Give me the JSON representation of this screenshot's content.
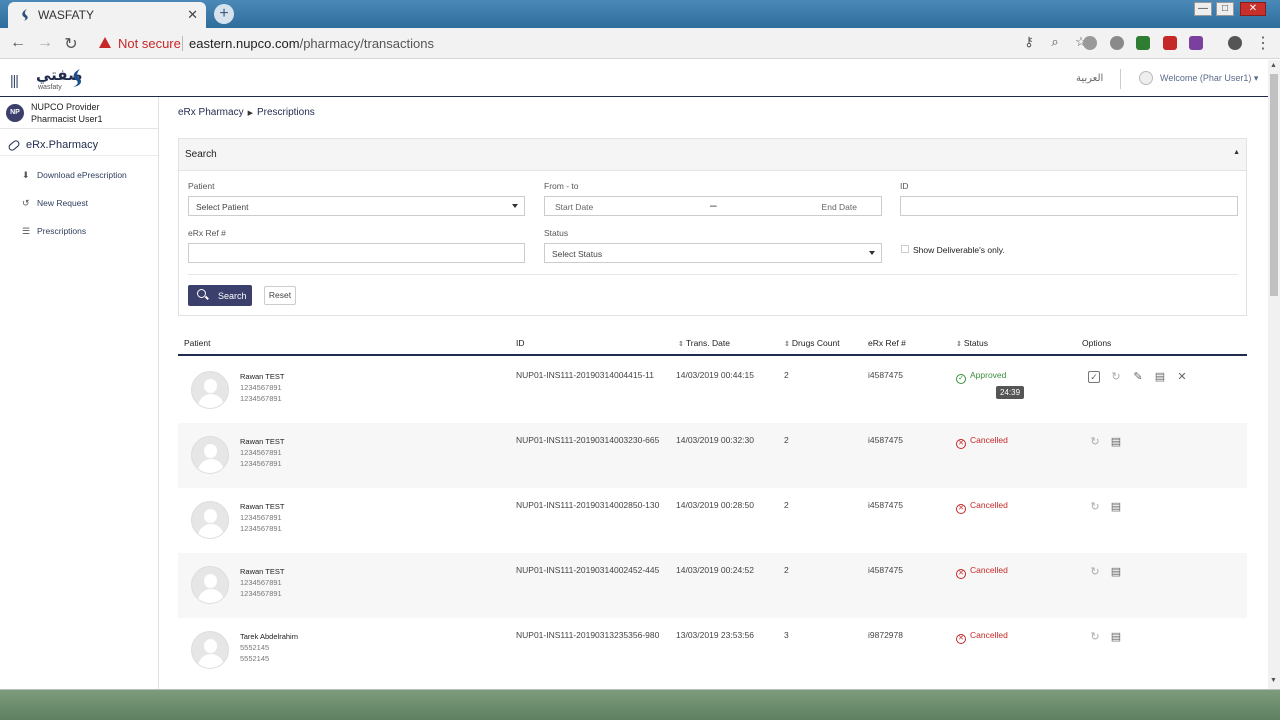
{
  "browser": {
    "tab_title": "WASFATY",
    "tab_close": "✕",
    "new_tab": "+",
    "security_label": "Not secure",
    "url_host": "eastern.nupco.com",
    "url_path": "/pharmacy/transactions",
    "window_controls": [
      "—",
      "□",
      "✕"
    ]
  },
  "header": {
    "logo_ar": "صفتي",
    "logo_en": "wasfaty",
    "language": "العربية",
    "welcome": "Welcome (Phar User1) ▾"
  },
  "sidebar": {
    "avatar_initials": "NP",
    "provider": "NUPCO Provider",
    "user_role": "Pharmacist User1",
    "module": "eRx.Pharmacy",
    "items": [
      {
        "label": "Download ePrescription",
        "icon": "download-icon"
      },
      {
        "label": "New Request",
        "icon": "history-icon"
      },
      {
        "label": "Prescriptions",
        "icon": "list-icon"
      }
    ]
  },
  "breadcrumb": {
    "parent": "eRx Pharmacy",
    "current": "Prescriptions"
  },
  "search": {
    "title": "Search",
    "patient_label": "Patient",
    "patient_placeholder": "Select Patient",
    "fromto_label": "From - to",
    "start_placeholder": "Start Date",
    "end_placeholder": "End Date",
    "id_label": "ID",
    "ref_label": "eRx Ref #",
    "status_label": "Status",
    "status_placeholder": "Select Status",
    "deliverable_label": "Show Deliverable's only.",
    "search_button": "Search",
    "reset_button": "Reset"
  },
  "table": {
    "columns": [
      "Patient",
      "ID",
      "Trans. Date",
      "Drugs Count",
      "eRx Ref #",
      "Status",
      "Options"
    ],
    "rows": [
      {
        "name": "Rawan TEST",
        "num1": "1234567891",
        "num2": "1234567891",
        "id": "NUP01-INS111-20190314004415-11",
        "date": "14/03/2019 00:44:15",
        "count": "2",
        "ref": "i4587475",
        "status": "Approved",
        "status_type": "approved",
        "tooltip": "24:39"
      },
      {
        "name": "Rawan TEST",
        "num1": "1234567891",
        "num2": "1234567891",
        "id": "NUP01-INS111-20190314003230-665",
        "date": "14/03/2019 00:32:30",
        "count": "2",
        "ref": "i4587475",
        "status": "Cancelled",
        "status_type": "cancelled"
      },
      {
        "name": "Rawan TEST",
        "num1": "1234567891",
        "num2": "1234567891",
        "id": "NUP01-INS111-20190314002850-130",
        "date": "14/03/2019 00:28:50",
        "count": "2",
        "ref": "i4587475",
        "status": "Cancelled",
        "status_type": "cancelled"
      },
      {
        "name": "Rawan TEST",
        "num1": "1234567891",
        "num2": "1234567891",
        "id": "NUP01-INS111-20190314002452-445",
        "date": "14/03/2019 00:24:52",
        "count": "2",
        "ref": "i4587475",
        "status": "Cancelled",
        "status_type": "cancelled"
      },
      {
        "name": "Tarek Abdelrahim",
        "num1": "5552145",
        "num2": "5552145",
        "id": "NUP01-INS111-20190313235356-980",
        "date": "13/03/2019 23:53:56",
        "count": "3",
        "ref": "i9872978",
        "status": "Cancelled",
        "status_type": "cancelled"
      }
    ]
  }
}
